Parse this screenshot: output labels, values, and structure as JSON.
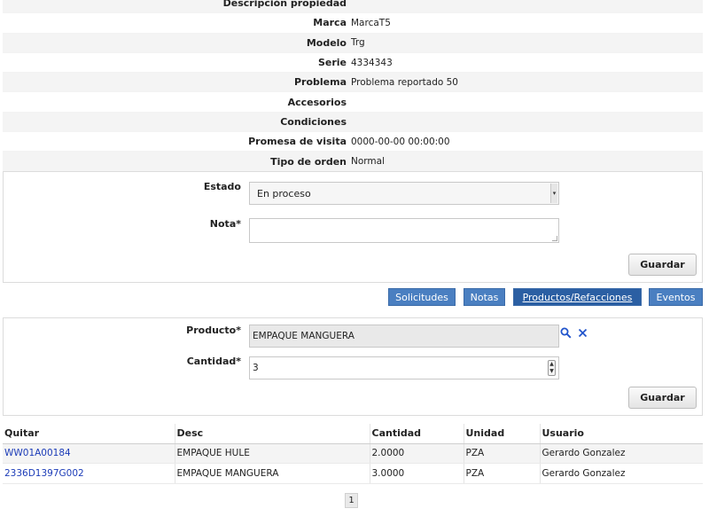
{
  "details": [
    {
      "label": "Descripción propiedad",
      "value": ""
    },
    {
      "label": "Marca",
      "value": "MarcaT5"
    },
    {
      "label": "Modelo",
      "value": "Trg"
    },
    {
      "label": "Serie",
      "value": "4334343"
    },
    {
      "label": "Problema",
      "value": "Problema reportado 50"
    },
    {
      "label": "Accesorios",
      "value": ""
    },
    {
      "label": "Condiciones",
      "value": ""
    },
    {
      "label": "Promesa de visita",
      "value": "0000-00-00 00:00:00"
    },
    {
      "label": "Tipo de orden",
      "value": "Normal"
    }
  ],
  "status_form": {
    "estado_label": "Estado",
    "estado_value": "En proceso",
    "nota_label": "Nota*",
    "nota_value": "",
    "save_label": "Guardar"
  },
  "tabs": [
    {
      "label": "Solicitudes",
      "active": false
    },
    {
      "label": "Notas",
      "active": false
    },
    {
      "label": "Productos/Refacciones",
      "active": true
    },
    {
      "label": "Eventos",
      "active": false
    }
  ],
  "product_form": {
    "producto_label": "Producto*",
    "producto_value": "EMPAQUE MANGUERA",
    "cantidad_label": "Cantidad*",
    "cantidad_value": "3",
    "save_label": "Guardar"
  },
  "products_table": {
    "headers": [
      "Quitar",
      "Desc",
      "Cantidad",
      "Unidad",
      "Usuario"
    ],
    "rows": [
      [
        "WW01A00184",
        "EMPAQUE HULE",
        "2.0000",
        "PZA",
        "Gerardo Gonzalez"
      ],
      [
        "2336D1397G002",
        "EMPAQUE MANGUERA",
        "3.0000",
        "PZA",
        "Gerardo Gonzalez"
      ]
    ]
  },
  "pagination": {
    "current_page": "1"
  },
  "icons": {
    "search": "search-icon",
    "clear": "close-icon",
    "select_arrow": "chevron-down-icon"
  },
  "colors": {
    "tab": "#4a7fc1",
    "tab_active": "#2b5fa3",
    "link": "#1c3cb8"
  }
}
